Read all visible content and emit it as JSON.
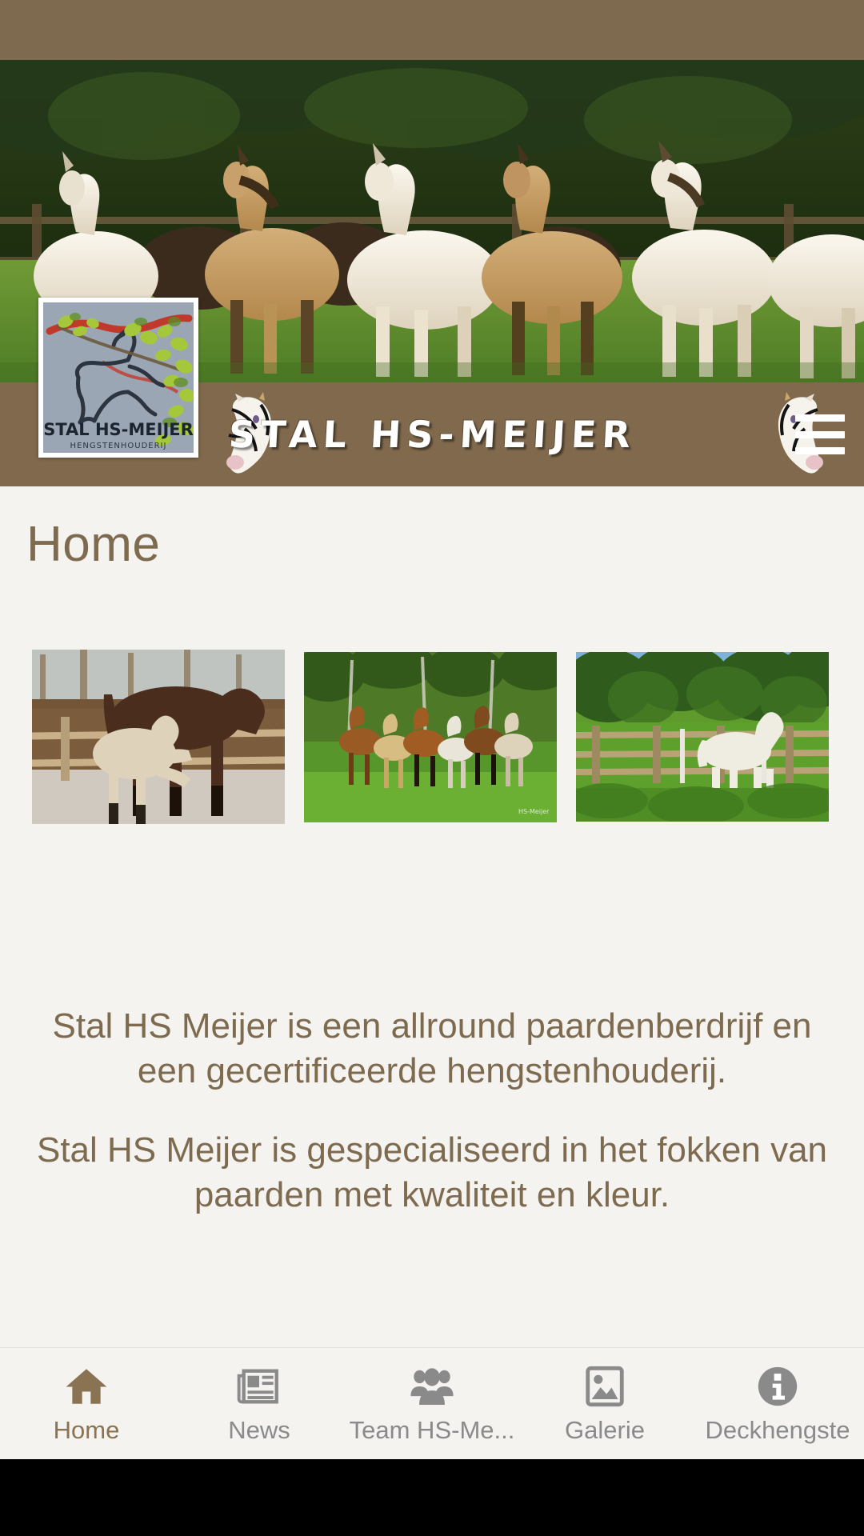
{
  "app": {
    "brand_name": "STAL  HS-MEIJER",
    "accent_color": "#80694c",
    "background_color": "#f4f3f0",
    "status_bar_color": "#7d6a4f"
  },
  "logo": {
    "title": "STAL HS-MEIJER",
    "subtitle": "HENGSTENHOUDERIJ"
  },
  "header": {
    "menu_icon": "hamburger-menu-icon",
    "horse_icon_left": "horse-head-icon",
    "horse_icon_right": "horse-head-icon"
  },
  "page": {
    "title": "Home"
  },
  "gallery": {
    "items": [
      {
        "name": "foal-with-mare-photo",
        "alt": "Creme foal rearing next to dark bay mare at fence"
      },
      {
        "name": "herd-running-photo",
        "alt": "Herd of horses galloping in green pasture"
      },
      {
        "name": "white-foal-photo",
        "alt": "White foal standing by wooden fence"
      }
    ]
  },
  "intro": {
    "paragraphs": [
      "Stal HS Meijer is een allround paardenberdrijf en een gecertificeerde hengstenhouderij.",
      "Stal HS Meijer is gespecialiseerd in het fokken van paarden met kwaliteit en kleur."
    ]
  },
  "tabbar": {
    "active_index": 0,
    "items": [
      {
        "label": "Home",
        "icon": "home-icon"
      },
      {
        "label": "News",
        "icon": "newspaper-icon"
      },
      {
        "label": "Team HS-Me...",
        "icon": "people-group-icon"
      },
      {
        "label": "Galerie",
        "icon": "image-icon"
      },
      {
        "label": "Deckhengste",
        "icon": "info-circle-icon"
      }
    ]
  }
}
